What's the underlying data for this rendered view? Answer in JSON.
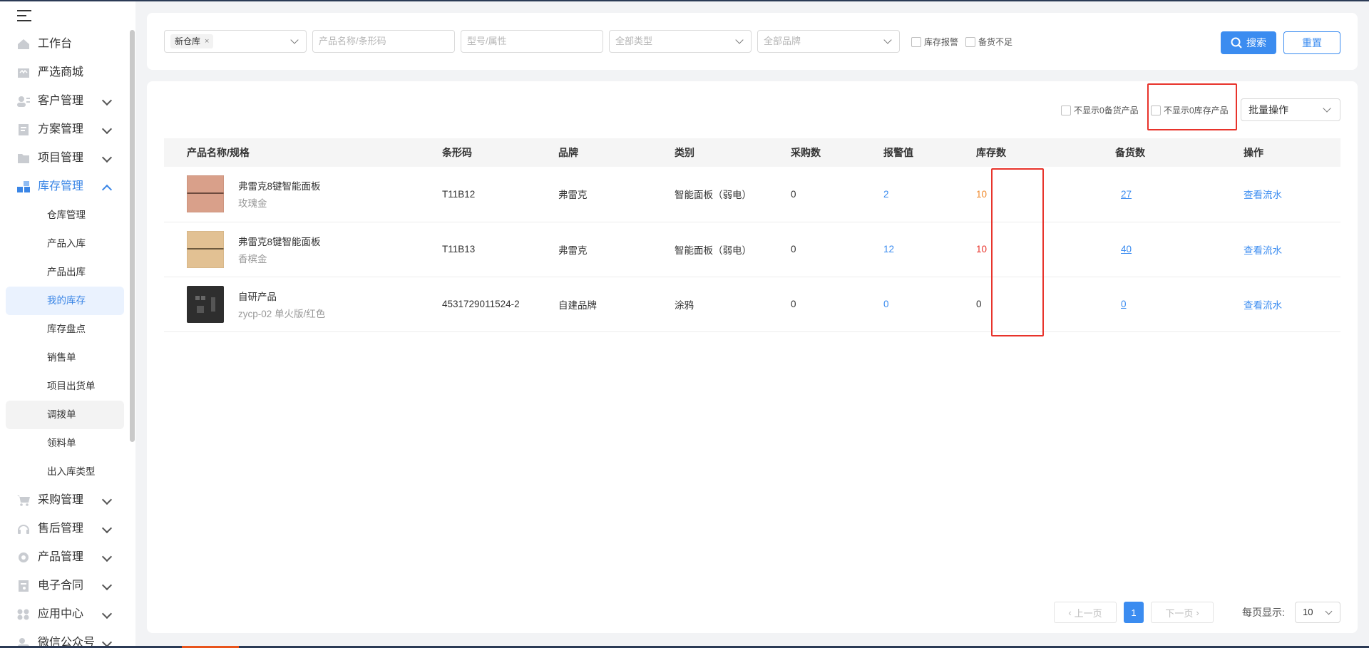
{
  "sidebar": {
    "items": [
      {
        "label": "工作台"
      },
      {
        "label": "严选商城"
      },
      {
        "label": "客户管理"
      },
      {
        "label": "方案管理"
      },
      {
        "label": "项目管理"
      },
      {
        "label": "库存管理"
      },
      {
        "label": "采购管理"
      },
      {
        "label": "售后管理"
      },
      {
        "label": "产品管理"
      },
      {
        "label": "电子合同"
      },
      {
        "label": "应用中心"
      },
      {
        "label": "微信公众号"
      }
    ],
    "sub_items": [
      {
        "label": "仓库管理"
      },
      {
        "label": "产品入库"
      },
      {
        "label": "产品出库"
      },
      {
        "label": "我的库存"
      },
      {
        "label": "库存盘点"
      },
      {
        "label": "销售单"
      },
      {
        "label": "项目出货单"
      },
      {
        "label": "调拨单"
      },
      {
        "label": "领料单"
      },
      {
        "label": "出入库类型"
      }
    ]
  },
  "filter": {
    "warehouse_tag": "新仓库",
    "tag_close": "×",
    "name_placeholder": "产品名称/条形码",
    "model_placeholder": "型号/属性",
    "type_placeholder": "全部类型",
    "brand_placeholder": "全部品牌",
    "alarm_label": "库存报警",
    "shortage_label": "备货不足",
    "search_label": "搜索",
    "reset_label": "重置"
  },
  "options": {
    "hide_zero_prep": "不显示0备货产品",
    "hide_zero_stock": "不显示0库存产品",
    "batch_label": "批量操作"
  },
  "table": {
    "headers": [
      "产品名称/规格",
      "条形码",
      "品牌",
      "类别",
      "采购数",
      "报警值",
      "库存数",
      "备货数",
      "操作"
    ],
    "rows": [
      {
        "name": "弗雷克8键智能面板",
        "spec": "玫瑰金",
        "barcode": "T11B12",
        "brand": "弗雷克",
        "category": "智能面板（弱电）",
        "purchase": "0",
        "alarm": "2",
        "stock": "10",
        "prep": "27",
        "action": "查看流水",
        "stock_color": "#f08a2c",
        "thumb_color": "#d9a08a"
      },
      {
        "name": "弗雷克8键智能面板",
        "spec": "香槟金",
        "barcode": "T11B13",
        "brand": "弗雷克",
        "category": "智能面板（弱电）",
        "purchase": "0",
        "alarm": "12",
        "stock": "10",
        "prep": "40",
        "action": "查看流水",
        "stock_color": "#e8332b",
        "thumb_color": "#e2c193"
      },
      {
        "name": "自研产品",
        "spec": "zycp-02 单火版/红色",
        "barcode": "4531729011524-2",
        "brand": "自建品牌",
        "category": "涂鸦",
        "purchase": "0",
        "alarm": "0",
        "stock": "0",
        "prep": "0",
        "action": "查看流水",
        "stock_color": "#333333",
        "thumb_color": "#2e2e2e"
      }
    ]
  },
  "pagination": {
    "prev": "上一页",
    "current": "1",
    "next": "下一页",
    "per_page_label": "每页显示:",
    "per_page_value": "10"
  },
  "colors": {
    "accent": "#3b8cf0",
    "highlight": "#e8332b"
  }
}
